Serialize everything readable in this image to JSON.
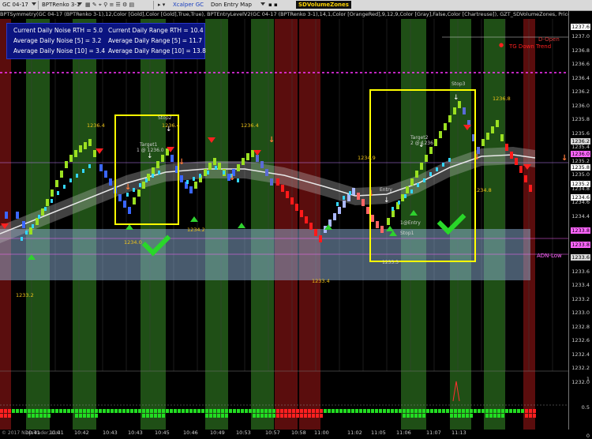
{
  "toolbar": {
    "instrument": "GC 04-17",
    "bar_type": "BPTRenko 3-1",
    "xcalper_label": "Xcalper GC",
    "entry_map": "Don Entry Map",
    "sd_volume_zones": "SDVolumeZones"
  },
  "indicator_line": "BPTSymmetry(GC 04-17 (BPTRenko 3-1),12,Color [Gold],Color [Gold],True,True), BPTEntryLevelV2(GC 04-17 (BPTRenko 3-1),14,1,Color [OrangeRed],9,12,9,Color [Gray],False,Color [Chartreuse]), GZT_SDVolumeZones, PriceLineWH(GC 04-17 (BPTR",
  "stats": {
    "noise_rth": "Current Daily Noise RTH = 5.0",
    "range_rth": "Current Daily Range RTH = 10.4",
    "avg_noise_5": "Average Daily Noise [5] = 3.2",
    "avg_range_5": "Average Daily Range [5] = 11.7",
    "avg_noise_10": "Average Daily Noise [10] = 3.4",
    "avg_range_10": "Average Daily Range [10] = 13.8"
  },
  "legend": {
    "d_open": "D-Open",
    "tg_down_trend": "TG Down Trend",
    "adn_low": "ADN-Low"
  },
  "price_axis": [
    "1237.0",
    "1236.8",
    "1236.6",
    "1236.4",
    "1236.2",
    "1236.0",
    "1235.8",
    "1235.6",
    "1235.4",
    "1235.2",
    "1235.0",
    "1234.8",
    "1234.6",
    "1234.4",
    "1234.2",
    "1234.0",
    "1233.8",
    "1233.6",
    "1233.4",
    "1233.2",
    "1233.0",
    "1232.8",
    "1232.6",
    "1232.4",
    "1232.2",
    "1232.0"
  ],
  "price_boxes": {
    "top": "1237.6",
    "p1": "1236.2",
    "p2": "1236.0",
    "p3": "1235.8",
    "p4": "1235.2",
    "p5": "1234.6",
    "p6": "1233.8",
    "p7": "1233.8",
    "p8": "1233.6"
  },
  "lower_axis": [
    "1",
    "0.5",
    "0"
  ],
  "time_axis": [
    "10:41",
    "10:41",
    "10:42",
    "10:43",
    "10:43",
    "10:45",
    "10:46",
    "10:49",
    "10:53",
    "10:57",
    "10:58",
    "11:00",
    "11:02",
    "11:05",
    "11:06",
    "11:07",
    "11:13"
  ],
  "annotations": {
    "stop_left": "Stop2",
    "target_left": "Target1",
    "target_left2": "1 @ 1236.0",
    "target2_right": "Target2",
    "target2_right_sub": "2 @ 1236",
    "stop_right": "Stop3",
    "entry_right": "Entry",
    "entry_right2": "1@Entry",
    "stop_right_sub": "Stop1",
    "p_1236_4_a": "1236.4",
    "p_1236_4_b": "1236.4",
    "p_1236_4_c": "1236.4",
    "p_1234_9": "1234.9",
    "p_1234_0": "1234.0",
    "p_1234_2": "1234.2",
    "p_1233_2": "1233.2",
    "p_1233_4": "1233.4",
    "p_1236_8": "1236.8",
    "p_1234_8": "1234.8",
    "p_1233_3": "1233.3"
  },
  "copyright": "© 2017 NinjaTrader, LLC",
  "colors": {
    "green_zone": "#1f4f16",
    "red_zone": "#5a0d0d",
    "band": "#8fb3d9",
    "bull": "#9be021",
    "bear": "#ff1a1a",
    "cyan": "#33d6ff",
    "highlight": "#ffff00"
  }
}
